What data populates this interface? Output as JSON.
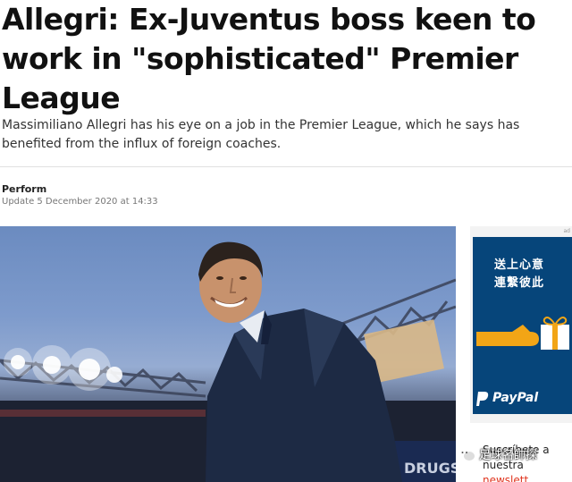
{
  "article": {
    "headline": "Allegri: Ex-Juventus boss keen to work in \"sophisticated\" Premier League",
    "standfirst": "Massimiliano Allegri has his eye on a job in the Premier League, which he says has benefited from the influx of foreign coaches.",
    "source": "Perform",
    "updated": "Update 5 December 2020 at 14:33"
  },
  "hero": {
    "banner_text": "DRUGS"
  },
  "ad": {
    "badge": "ad",
    "line1": "送上心意",
    "line2": "連繫彼此",
    "brand": "PayPal",
    "colors": {
      "background": "#06457a",
      "gift": "#f2a516"
    }
  },
  "newsletter": {
    "line1": "Suscríbete a",
    "line2_prefix": "nuestra ",
    "line2_accent": "newslett"
  },
  "watermark": {
    "text": "足球名帥探"
  }
}
